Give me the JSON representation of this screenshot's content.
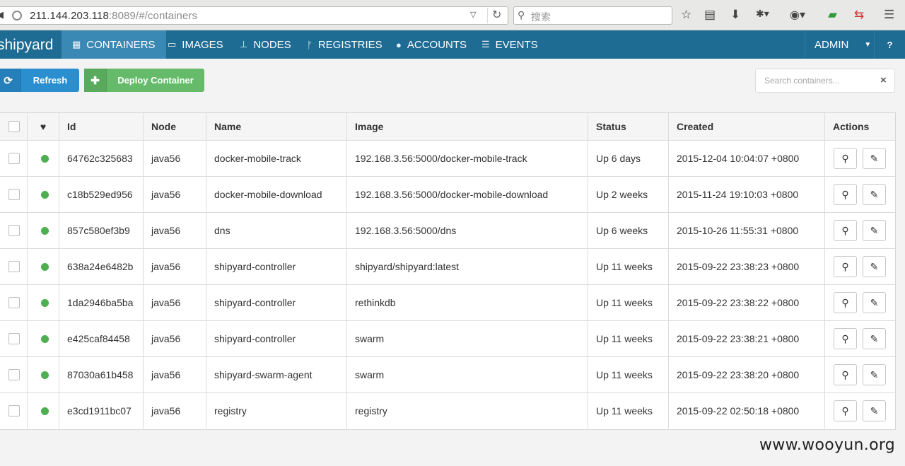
{
  "browser": {
    "url_host": "211.144.203.118",
    "url_rest": ":8089/#/containers",
    "search_placeholder": "搜索"
  },
  "nav": {
    "brand": "shipyard",
    "items": [
      {
        "label": "CONTAINERS",
        "icon": "grid-icon"
      },
      {
        "label": "IMAGES",
        "icon": "hdd-icon"
      },
      {
        "label": "NODES",
        "icon": "sitemap-icon"
      },
      {
        "label": "REGISTRIES",
        "icon": "branch-icon"
      },
      {
        "label": "ACCOUNTS",
        "icon": "user-icon"
      },
      {
        "label": "EVENTS",
        "icon": "list-icon"
      }
    ],
    "admin_label": "ADMIN",
    "help_label": "?"
  },
  "toolbar": {
    "refresh_label": "Refresh",
    "deploy_label": "Deploy Container",
    "search_placeholder": "Search containers...",
    "clear_label": "×"
  },
  "table": {
    "headers": [
      "Id",
      "Node",
      "Name",
      "Image",
      "Status",
      "Created",
      "Actions"
    ],
    "rows": [
      {
        "id": "64762c325683",
        "node": "java56",
        "name": "docker-mobile-track",
        "image": "192.168.3.56:5000/docker-mobile-track",
        "status": "Up 6 days",
        "created": "2015-12-04 10:04:07 +0800"
      },
      {
        "id": "c18b529ed956",
        "node": "java56",
        "name": "docker-mobile-download",
        "image": "192.168.3.56:5000/docker-mobile-download",
        "status": "Up 2 weeks",
        "created": "2015-11-24 19:10:03 +0800"
      },
      {
        "id": "857c580ef3b9",
        "node": "java56",
        "name": "dns",
        "image": "192.168.3.56:5000/dns",
        "status": "Up 6 weeks",
        "created": "2015-10-26 11:55:31 +0800"
      },
      {
        "id": "638a24e6482b",
        "node": "java56",
        "name": "shipyard-controller",
        "image": "shipyard/shipyard:latest",
        "status": "Up 11 weeks",
        "created": "2015-09-22 23:38:23 +0800"
      },
      {
        "id": "1da2946ba5ba",
        "node": "java56",
        "name": "shipyard-controller",
        "image": "rethinkdb",
        "status": "Up 11 weeks",
        "created": "2015-09-22 23:38:22 +0800"
      },
      {
        "id": "e425caf84458",
        "node": "java56",
        "name": "shipyard-controller",
        "image": "swarm",
        "status": "Up 11 weeks",
        "created": "2015-09-22 23:38:21 +0800"
      },
      {
        "id": "87030a61b458",
        "node": "java56",
        "name": "shipyard-swarm-agent",
        "image": "swarm",
        "status": "Up 11 weeks",
        "created": "2015-09-22 23:38:20 +0800"
      },
      {
        "id": "e3cd1911bc07",
        "node": "java56",
        "name": "registry",
        "image": "registry",
        "status": "Up 11 weeks",
        "created": "2015-09-22 02:50:18 +0800"
      }
    ]
  },
  "watermark": "www.wooyun.org"
}
